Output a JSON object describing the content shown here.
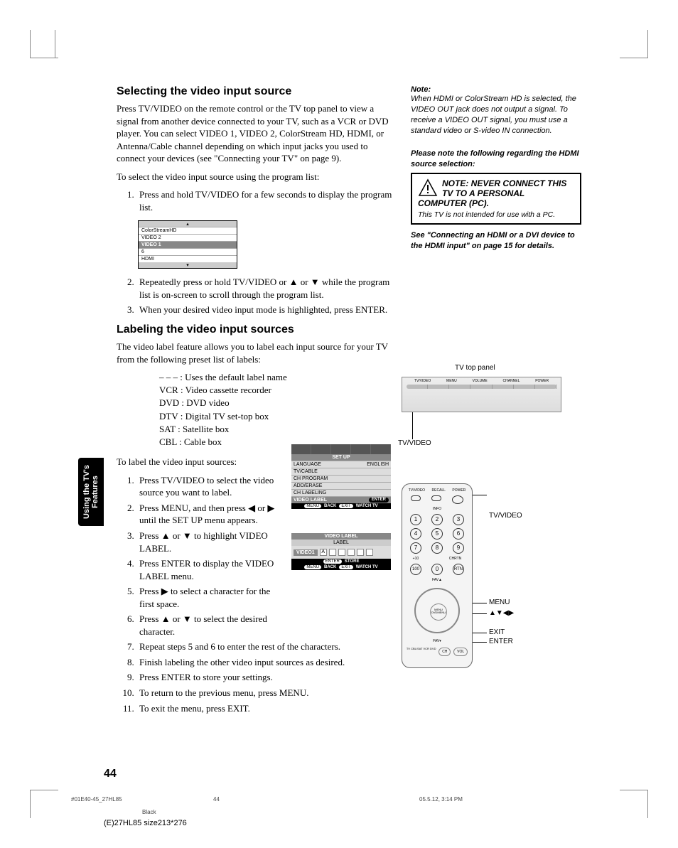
{
  "section1": {
    "heading": "Selecting the video input source",
    "p1": "Press TV/VIDEO on the remote control or the TV top panel to view a signal from another device connected to your TV, such as a VCR or DVD player. You can select VIDEO 1, VIDEO 2, ColorStream HD, HDMI, or Antenna/Cable channel depending on which input jacks you used to connect your devices (see \"Connecting your TV\" on page 9).",
    "p2": "To select the video input source using the program list:",
    "step1": "Press and hold TV/VIDEO for a few seconds to display the program list.",
    "step2": "Repeatedly press or hold TV/VIDEO or ▲ or ▼ while the program list is on-screen to scroll through the program list.",
    "step3": "When your desired video input mode is highlighted, press ENTER."
  },
  "prog_list": {
    "r1": "ColorStreamHD",
    "r2": "VIDEO 2",
    "r3": "VIDEO 1",
    "r4": "6",
    "r5": "HDMI"
  },
  "section2": {
    "heading": "Labeling the video input sources",
    "p1": "The video label feature allows you to label each input source for your TV from the following preset list of labels:",
    "labels": {
      "l1": "– – –   : Uses the default label name",
      "l2": "VCR   : Video cassette recorder",
      "l3": "DVD  : DVD video",
      "l4": "DTV   : Digital TV set-top box",
      "l5": "SAT    : Satellite box",
      "l6": "CBL   : Cable box"
    },
    "p2": "To label the video input sources:",
    "steps": {
      "s1": "Press TV/VIDEO to select the video source you want to label.",
      "s2": "Press MENU, and then press ◀ or ▶ until the SET UP menu appears.",
      "s3": "Press ▲ or ▼ to highlight VIDEO LABEL.",
      "s4": "Press ENTER to display the VIDEO LABEL menu.",
      "s5": "Press ▶ to select a character for the first space.",
      "s6": "Press ▲ or ▼ to select the desired character.",
      "s7": "Repeat steps 5 and 6 to enter the rest of the characters.",
      "s8": "Finish labeling the other video input sources as desired.",
      "s9": "Press ENTER to store your settings.",
      "s10": "To return to the previous menu, press MENU.",
      "s11": "To exit the menu, press EXIT."
    }
  },
  "right": {
    "note_head": "Note:",
    "note_body": "When HDMI or ColorStream HD is selected, the VIDEO OUT jack does not output a signal. To receive a VIDEO OUT signal, you must use a standard video or S-video IN connection.",
    "warn_head": "Please note the following regarding the HDMI source selection:",
    "warn_title": "NOTE: NEVER CONNECT THIS TV TO A PERSONAL COMPUTER (PC).",
    "warn_sub": "This TV is not intended for use with a PC.",
    "see": "See \"Connecting an HDMI or a DVI device to the HDMI input\" on page 15 for details."
  },
  "setup": {
    "title": "SET UP",
    "r1": "LANGUAGE",
    "r1v": "ENGLISH",
    "r2": "TV/CABLE",
    "r3": "CH PROGRAM",
    "r4": "ADD/ERASE",
    "r5": "CH LABELING",
    "r6": "VIDEO LABEL",
    "enter": "ENTER",
    "f1": "MENU",
    "f1t": "BACK",
    "f2": "EXIT",
    "f2t": "WATCH TV"
  },
  "vlabel": {
    "title": "VIDEO LABEL",
    "sub": "LABEL",
    "v1": "VIDEO1",
    "ch": "A",
    "f1": "ENTER",
    "f1t": "STORE",
    "f2": "MENU",
    "f2t": "BACK",
    "f3": "EXIT",
    "f3t": "WATCH TV"
  },
  "tv_panel": {
    "label": "TV top panel",
    "b1": "TV/VIDEO",
    "b2": "MENU",
    "b3": "VOLUME",
    "b4": "CHANNEL",
    "b5": "POWER",
    "callout": "TV/VIDEO"
  },
  "remote": {
    "top1": "TV/VIDEO",
    "top2": "RECALL",
    "top3": "POWER",
    "info": "INFO",
    "n1": "1",
    "n2": "2",
    "n3": "3",
    "n4": "4",
    "n5": "5",
    "n6": "6",
    "n7": "7",
    "n8": "8",
    "n9": "9",
    "n0": "0",
    "n100": "100",
    "nrtn": "RTN",
    "plus10": "+10",
    "chrtn": "CHRTN",
    "fav": "FAV▲",
    "center": "MENU DVDMENU",
    "exit": "EXIT",
    "mode": "TV CBL/SAT VCR DVD",
    "ch": "CH",
    "vol": "VOL",
    "co_tvvideo": "TV/VIDEO",
    "co_menu": "MENU",
    "co_arrows": "▲▼◀▶",
    "co_exit": "EXIT",
    "co_enter": "ENTER"
  },
  "side_tab": "Using the TV's Features",
  "page_num": "44",
  "footer": {
    "file": "#01E40-45_27HL85",
    "pg": "44",
    "date": "05.5.12, 3:14 PM",
    "black": "Black",
    "size": "(E)27HL85 size213*276"
  }
}
